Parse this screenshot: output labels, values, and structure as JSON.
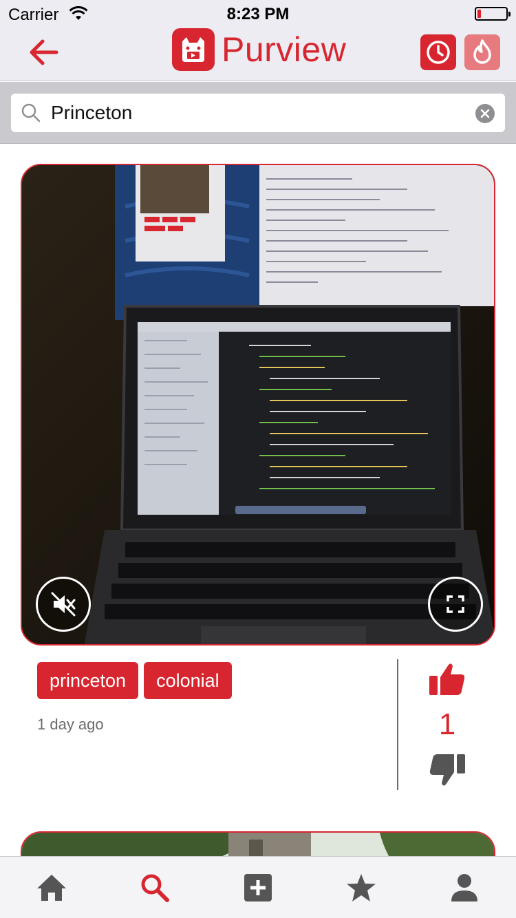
{
  "status_bar": {
    "carrier": "Carrier",
    "time": "8:23 PM",
    "battery_level": 0.1
  },
  "nav": {
    "title": "Purview",
    "back_icon": "arrow-left-icon",
    "recent_icon": "clock-icon",
    "hot_icon": "flame-icon"
  },
  "search": {
    "value": "Princeton",
    "placeholder": ""
  },
  "posts": [
    {
      "tags": [
        "princeton",
        "colonial"
      ],
      "posted": "1 day ago",
      "votes": "1",
      "media_controls": [
        "mute-icon",
        "fullscreen-icon"
      ]
    }
  ],
  "tab_bar": {
    "items": [
      "home-icon",
      "search-icon",
      "add-icon",
      "star-icon",
      "profile-icon"
    ],
    "active": "search-icon"
  },
  "colors": {
    "accent": "#d7262f",
    "accent_light": "#e67a7f",
    "inactive": "#555555"
  }
}
